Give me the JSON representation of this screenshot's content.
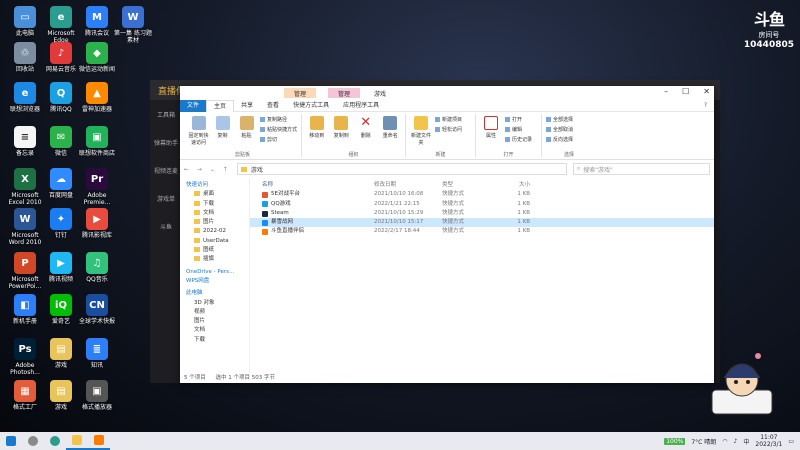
{
  "desktop": {
    "icons": [
      {
        "label": "此电脑",
        "color": "#4a90d9",
        "glyph": "▭"
      },
      {
        "label": "Microsoft Edge",
        "color": "#2a9d8f",
        "glyph": "e"
      },
      {
        "label": "腾讯会议",
        "color": "#2d7ff9",
        "glyph": "M"
      },
      {
        "label": "第一集 练习题素材",
        "color": "#3b6fd1",
        "glyph": "W"
      },
      {
        "label": "回收站",
        "color": "#7d8da1",
        "glyph": "♲"
      },
      {
        "label": "网易云音乐",
        "color": "#e03a3a",
        "glyph": "♪"
      },
      {
        "label": "微信运动新闻",
        "color": "#2bb24c",
        "glyph": "◆"
      },
      {
        "label": "联想浏览器",
        "color": "#1e88e5",
        "glyph": "e"
      },
      {
        "label": "腾讯QQ",
        "color": "#1ba1e2",
        "glyph": "Q"
      },
      {
        "label": "雷神加速器",
        "color": "#ff8a00",
        "glyph": "▲"
      },
      {
        "label": "备忘录",
        "color": "#f5f5f5",
        "glyph": "≡"
      },
      {
        "label": "微信",
        "color": "#2bb24c",
        "glyph": "✉"
      },
      {
        "label": "联想软件商店",
        "color": "#1fb45a",
        "glyph": "▣"
      },
      {
        "label": "Microsoft Excel 2010",
        "color": "#1e7145",
        "glyph": "X"
      },
      {
        "label": "百度网盘",
        "color": "#2f8bff",
        "glyph": "☁"
      },
      {
        "label": "Adobe Premie...",
        "color": "#2b0a3d",
        "glyph": "Pr"
      },
      {
        "label": "Microsoft Word 2010",
        "color": "#2b5797",
        "glyph": "W"
      },
      {
        "label": "钉钉",
        "color": "#1a7ef2",
        "glyph": "✦"
      },
      {
        "label": "腾讯影视库",
        "color": "#e94b3c",
        "glyph": "▶"
      },
      {
        "label": "Microsoft PowerPoi...",
        "color": "#d24726",
        "glyph": "P"
      },
      {
        "label": "腾讯视频",
        "color": "#1fb8f2",
        "glyph": "▶"
      },
      {
        "label": "QQ音乐",
        "color": "#31c27c",
        "glyph": "♫"
      },
      {
        "label": "新机手册",
        "color": "#2d7ff9",
        "glyph": "◧"
      },
      {
        "label": "爱奇艺",
        "color": "#00be06",
        "glyph": "iQ"
      },
      {
        "label": "全球学术快报",
        "color": "#1a4fa0",
        "glyph": "CN"
      },
      {
        "label": "Adobe Photosh...",
        "color": "#001e36",
        "glyph": "Ps"
      },
      {
        "label": "游戏",
        "color": "#e8c45a",
        "glyph": "▤"
      },
      {
        "label": "知讯",
        "color": "#2d7ff9",
        "glyph": "≣"
      },
      {
        "label": "格式工厂",
        "color": "#e35d3a",
        "glyph": "▦"
      },
      {
        "label": "游戏",
        "color": "#e8c45a",
        "glyph": "▤"
      },
      {
        "label": "格式播放器",
        "color": "#555555",
        "glyph": "▣"
      }
    ]
  },
  "watermark": {
    "brand": "斗鱼",
    "sub": "房间号",
    "id": "10440805"
  },
  "bg_app": {
    "title": "直播伴侣",
    "side": [
      "工具箱",
      "弹幕助手",
      "视频连麦",
      "游戏单",
      "斗鱼"
    ]
  },
  "window": {
    "ctx_tab1": "管理",
    "ctx_tab2": "管理",
    "title": "游戏",
    "menu": {
      "file": "文件",
      "home": "主页",
      "share": "共享",
      "view": "查看",
      "tools": "快捷方式工具",
      "apptools": "应用程序工具"
    },
    "ribbon": {
      "pin_label": "固定到快速访问",
      "copy_label": "复制",
      "paste_label": "粘贴",
      "copy_path": "复制路径",
      "paste_shortcut": "粘贴快捷方式",
      "cut": "剪切",
      "clipboard_group": "剪贴板",
      "move_to": "移动到",
      "copy_to": "复制到",
      "delete": "删除",
      "rename": "重命名",
      "organize_group": "组织",
      "new_folder": "新建文件夹",
      "new_item": "新建项目",
      "easy_access": "轻松访问",
      "new_group": "新建",
      "properties": "属性",
      "open": "打开",
      "edit": "编辑",
      "history": "历史记录",
      "open_group": "打开",
      "select_all": "全部选择",
      "select_none": "全部取消",
      "invert": "反向选择",
      "select_group": "选择"
    },
    "address": {
      "path": "游戏",
      "search_placeholder": "搜索\"游戏\""
    },
    "nav": {
      "quick_access": "快速访问",
      "items": [
        "桌面",
        "下载",
        "文档",
        "图片",
        "2022-02",
        "UserData",
        "图纸",
        "插旗"
      ],
      "onedrive": "OneDrive - Pers...",
      "wps": "WPS网盘",
      "this_pc": "此电脑",
      "pc_items": [
        "3D 对象",
        "视频",
        "图片",
        "文档",
        "下载"
      ]
    },
    "columns": {
      "name": "名称",
      "date": "修改日期",
      "type": "类型",
      "size": "大小"
    },
    "files": [
      {
        "name": "5E对战平台",
        "date": "2021/10/10 16:08",
        "type": "快捷方式",
        "size": "1 KB",
        "color": "#e4572e"
      },
      {
        "name": "QQ游戏",
        "date": "2022/1/21 22:15",
        "type": "快捷方式",
        "size": "1 KB",
        "color": "#1ba1e2"
      },
      {
        "name": "Steam",
        "date": "2021/10/10 15:29",
        "type": "快捷方式",
        "size": "1 KB",
        "color": "#1b2838"
      },
      {
        "name": "暴雪战网",
        "date": "2021/10/10 15:17",
        "type": "快捷方式",
        "size": "1 KB",
        "color": "#148eff"
      },
      {
        "name": "斗鱼直播伴侣",
        "date": "2022/2/17 18:44",
        "type": "快捷方式",
        "size": "1 KB",
        "color": "#ff7a00"
      }
    ],
    "status": {
      "count": "5 个项目",
      "selected": "选中 1 个项目  503 字节"
    }
  },
  "taskbar": {
    "battery": "100%",
    "weather": "7°C 晴朗",
    "ime": "中",
    "time": "11:07",
    "date": "2022/3/1"
  }
}
